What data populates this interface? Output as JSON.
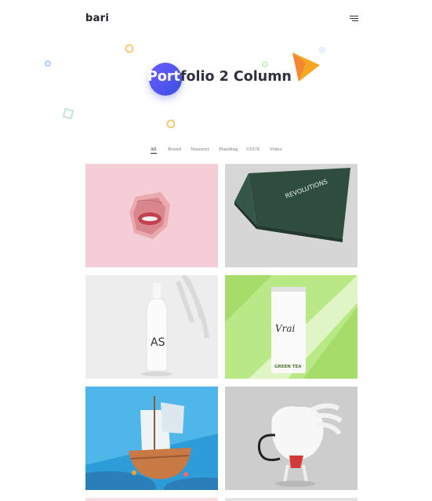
{
  "header": {
    "logo": "bari",
    "menu_icon": "hamburger-menu-icon"
  },
  "hero": {
    "title_part1": "Port",
    "title_part2": "folio 2 Column"
  },
  "filters": [
    "All",
    "Brand",
    "Mansory",
    "Planding",
    "UI/UX",
    "Video"
  ],
  "active_filter": "All",
  "tiles": [
    {
      "name": "pink-face-tile",
      "bg": "#f4cdd6"
    },
    {
      "name": "green-cards-tile",
      "bg": "#d6d6d6",
      "card_text": "REVOLUTIONS"
    },
    {
      "name": "white-bottle-tile",
      "bg": "#ededed",
      "bottle_text": "AS"
    },
    {
      "name": "green-tea-can-tile",
      "bg": "#b9e886",
      "can_text": "Vrai",
      "can_sub": "GREEN TEA"
    },
    {
      "name": "pirate-ship-tile",
      "bg": "#2e9cd8"
    },
    {
      "name": "white-creature-tile",
      "bg": "#cdcdcd"
    }
  ],
  "colors": {
    "accent": "#4a54f0",
    "triangle": "#f5a623",
    "text": "#2f3140"
  }
}
